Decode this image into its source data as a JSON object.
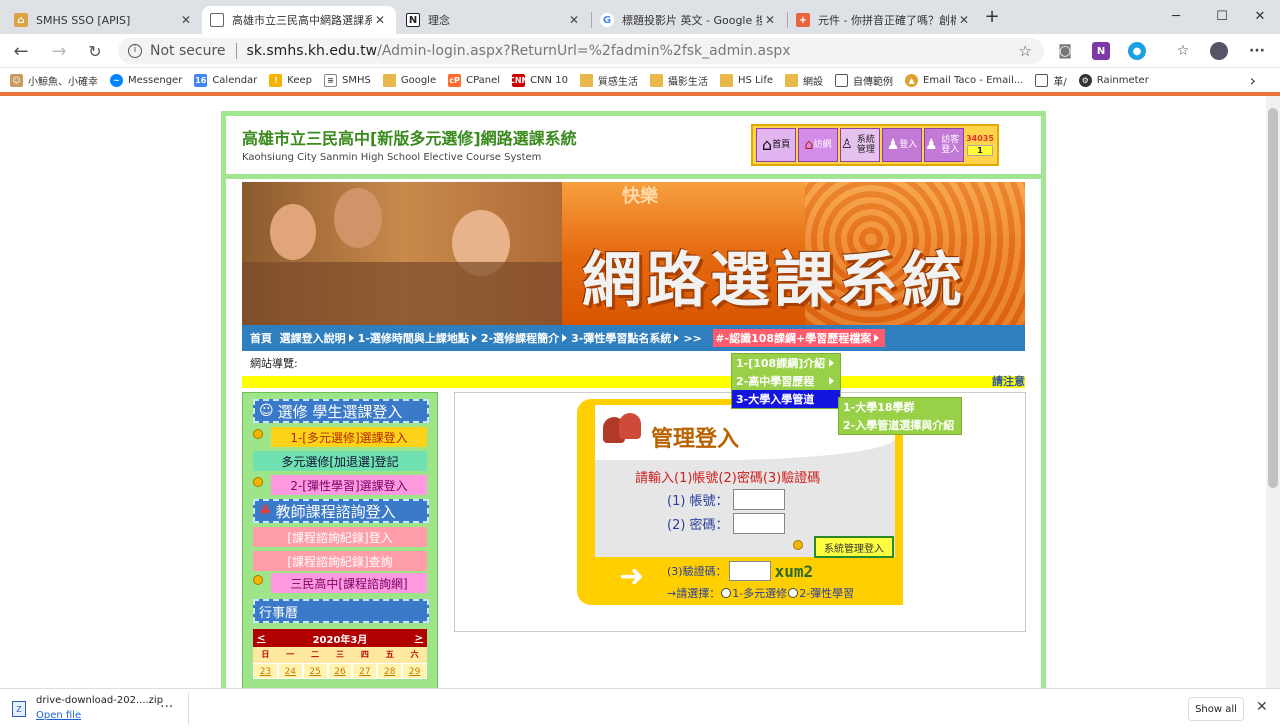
{
  "browser": {
    "tabs": [
      {
        "title": "SMHS SSO [APIS]",
        "icon": "smhs-logo"
      },
      {
        "title": "高雄市立三民高中網路選課系統",
        "icon": "page-icon"
      },
      {
        "title": "理念",
        "icon": "notion-icon"
      },
      {
        "title": "標題投影片 英文 - Google 搜尋",
        "icon": "google-icon"
      },
      {
        "title": "元件 - 你拼音正確了嗎？創橋英語",
        "icon": "component-icon"
      }
    ],
    "new_tab": "+",
    "window_min": "─",
    "window_max": "☐",
    "window_close": "✕",
    "omnibox": {
      "security": "Not secure",
      "host": "sk.smhs.kh.edu.tw",
      "path": "/Admin-login.aspx?ReturnUrl=%2fadmin%2fsk_admin.aspx"
    },
    "extensions": [
      "camera-icon",
      "onenote-icon",
      "extension-icon",
      "favorites-icon",
      "profile-avatar",
      "more-icon"
    ],
    "bookmarks": [
      {
        "label": "小鯨魚、小確幸",
        "icon": "person-icon"
      },
      {
        "label": "Messenger",
        "icon": "messenger-icon",
        "color": "#0084ff"
      },
      {
        "label": "Calendar",
        "icon": "calendar-icon",
        "color": "#4285f4"
      },
      {
        "label": "Keep",
        "icon": "keep-icon",
        "color": "#f4b400"
      },
      {
        "label": "SMHS",
        "icon": "smhs-icon",
        "color": "#666666"
      },
      {
        "label": "Google",
        "icon": "folder-icon"
      },
      {
        "label": "CPanel",
        "icon": "cpanel-icon",
        "color": "#ff6c2c"
      },
      {
        "label": "CNN 10",
        "icon": "cnn-icon",
        "color": "#cc0000"
      },
      {
        "label": "質感生活",
        "icon": "folder-icon"
      },
      {
        "label": "攝影生活",
        "icon": "folder-icon"
      },
      {
        "label": "HS Life",
        "icon": "folder-icon"
      },
      {
        "label": "網設",
        "icon": "folder-icon"
      },
      {
        "label": "自傳範例",
        "icon": "page-icon"
      },
      {
        "label": "Email Taco - Email...",
        "icon": "taco-icon",
        "color": "#e0a030"
      },
      {
        "label": "革/",
        "icon": "page-icon"
      },
      {
        "label": "Rainmeter",
        "icon": "rainmeter-icon",
        "color": "#333333"
      }
    ],
    "bookmarks_more": "›"
  },
  "site": {
    "title": "高雄市立三民高中[新版多元選修]網路選課系統",
    "subtitle": "Kaohsiung City Sanmin High School Elective Course System",
    "top_icons": [
      {
        "label": "首頁",
        "icon": "home-icon"
      },
      {
        "label": "訪網",
        "icon": "school-icon"
      },
      {
        "label": "系統管理",
        "icon": "admin-icon"
      },
      {
        "label": "登入",
        "icon": "login-icon"
      },
      {
        "label": "訪客登入",
        "icon": "guest-icon"
      }
    ],
    "visitor_count": "34035",
    "online_count": "1",
    "banner_title": "網路選課系統",
    "banner_sub": "快樂",
    "menu": [
      {
        "label": "首頁"
      },
      {
        "label": "選課登入說明"
      },
      {
        "label": "1-選修時間與上課地點"
      },
      {
        "label": "2-選修課程簡介"
      },
      {
        "label": "3-彈性學習點名系統"
      },
      {
        "label": ">>"
      },
      {
        "label": "#-認識108課綱+學習歷程檔案"
      }
    ],
    "site_nav_label": "網站導覽:",
    "notice": "請注意",
    "dropdown": [
      {
        "label": "1-[108課綱]介紹"
      },
      {
        "label": "2-高中學習歷程"
      },
      {
        "label": "3-大學入學管道"
      }
    ],
    "submenu": [
      {
        "label": "1-大學18學群"
      },
      {
        "label": "2-入學管道選擇與介紹"
      }
    ],
    "left": {
      "student_head": "選修 學生選課登入",
      "btn1": "1-[多元選修]選課登入",
      "btn2": "多元選修[加退選]登記",
      "btn3": "2-[彈性學習]選課登入",
      "teacher_head": "教師課程諮詢登入",
      "btn4": "[課程諮詢紀錄]登入",
      "btn5": "[課程諮詢紀錄]查詢",
      "btn6": "三民高中[課程諮詢網]",
      "calendar_head": "行事曆",
      "cal_prev": "<",
      "cal_next": ">",
      "cal_month": "2020年3月",
      "cal_dow": [
        "日",
        "一",
        "二",
        "三",
        "四",
        "五",
        "六"
      ],
      "cal_days": [
        "23",
        "24",
        "25",
        "26",
        "27",
        "28",
        "29"
      ]
    },
    "login": {
      "title": "管理登入",
      "instruction": "請輸入(1)帳號(2)密碼(3)驗證碼",
      "account_label": "(1) 帳號：",
      "password_label": "(2) 密碼：",
      "button": "系統管理登入",
      "captcha_label": "(3)驗證碼：",
      "captcha_code": "xum2",
      "choose_label": "→請選擇：",
      "option1": "1-多元選修",
      "option2": "2-彈性學習"
    }
  },
  "download": {
    "filename": "drive-download-202....zip",
    "open": "Open file",
    "more": "···",
    "show_all": "Show all",
    "close": "✕"
  }
}
